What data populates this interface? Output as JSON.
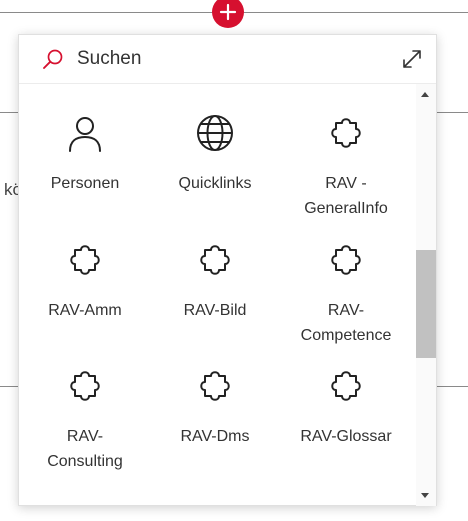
{
  "background": {
    "partial_text": "kö"
  },
  "search": {
    "label": "Suchen"
  },
  "apps": [
    {
      "label": "Personen",
      "icon": "person-icon"
    },
    {
      "label": "Quicklinks",
      "icon": "globe-icon"
    },
    {
      "label": "RAV -\nGeneralInfo",
      "icon": "puzzle-icon"
    },
    {
      "label": "RAV-Amm",
      "icon": "puzzle-icon"
    },
    {
      "label": "RAV-Bild",
      "icon": "puzzle-icon"
    },
    {
      "label": "RAV-\nCompetence",
      "icon": "puzzle-icon"
    },
    {
      "label": "RAV-\nConsulting",
      "icon": "puzzle-icon"
    },
    {
      "label": "RAV-Dms",
      "icon": "puzzle-icon"
    },
    {
      "label": "RAV-Glossar",
      "icon": "puzzle-icon"
    }
  ],
  "colors": {
    "accent": "#d6102f",
    "scroll_thumb": "#c1c1c1"
  }
}
